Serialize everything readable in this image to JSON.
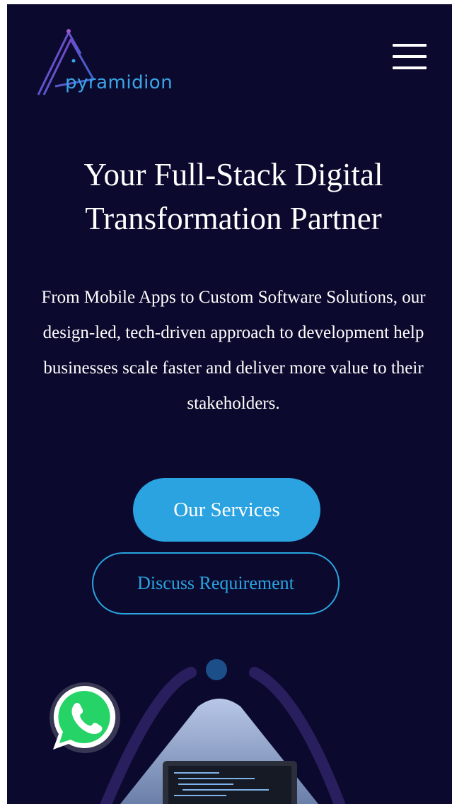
{
  "header": {
    "logo_text": "pyramidion",
    "menu_icon": "hamburger-menu-icon"
  },
  "hero": {
    "title_line1": "Your Full-Stack Digital",
    "title_line2": "Transformation Partner",
    "description": "From Mobile Apps to Custom Software Solutions, our design-led, tech-driven approach to development help businesses scale faster and deliver more value to their stakeholders.",
    "primary_button": "Our Services",
    "secondary_button": "Discuss Requirement"
  },
  "floating": {
    "whatsapp_icon": "whatsapp-icon"
  },
  "colors": {
    "background": "#0b0a2e",
    "accent": "#2aa3e0",
    "text": "#ffffff",
    "whatsapp_green": "#25d366"
  }
}
